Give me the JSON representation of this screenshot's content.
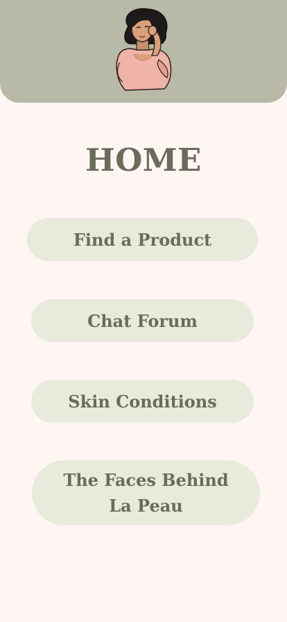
{
  "header": {
    "background_color": "#b8b9a6",
    "avatar_icon": "woman-illustration-icon"
  },
  "page": {
    "title": "HOME",
    "background_color": "#fff6f4",
    "text_color": "#6a6b5a",
    "button_color": "#e8eadb"
  },
  "menu": {
    "find_product_label": "Find a Product",
    "chat_forum_label": "Chat Forum",
    "skin_conditions_label": "Skin Conditions",
    "faces_behind_line1": "The Faces Behind",
    "faces_behind_line2": "La Peau"
  }
}
